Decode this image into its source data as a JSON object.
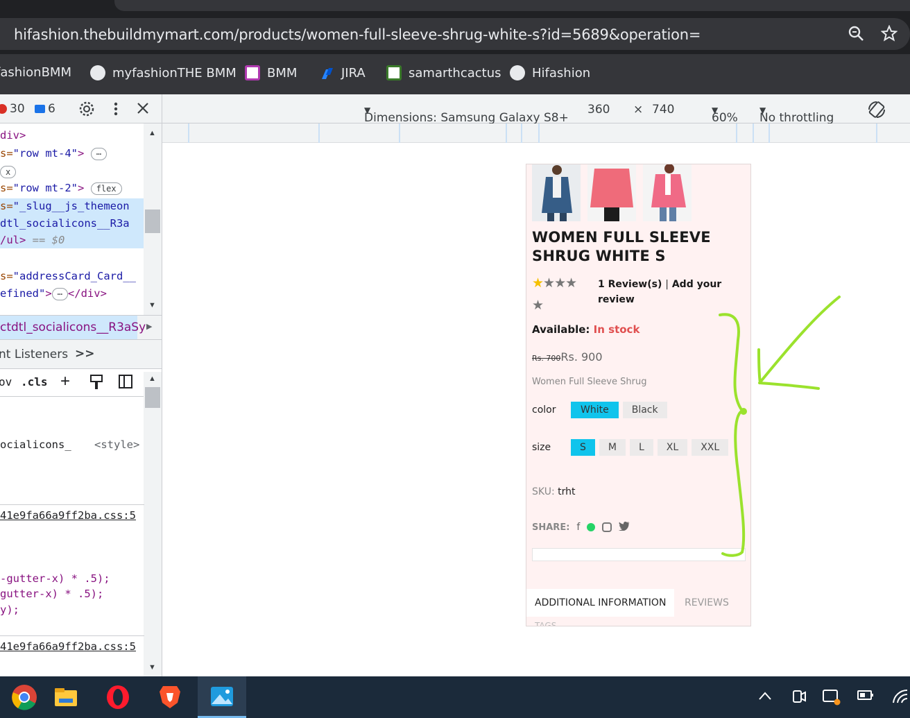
{
  "browser": {
    "url": "hifashion.thebuildmymart.com/products/women-full-sleeve-shrug-white-s?id=5689&operation=",
    "bookmarks": [
      "fashionBMM",
      "myfashionTHE BMM",
      "BMM",
      "JIRA",
      "samarthcactus",
      "Hifashion"
    ]
  },
  "devtools": {
    "error_count": "30",
    "message_count": "6",
    "code_lines": {
      "l1": "div>",
      "l2_attr": "s=",
      "l2_val": "\"row mt-4\"",
      "l2_end": ">",
      "l3": "x",
      "l4_attr": "s=",
      "l4_val": "\"row mt-2\"",
      "l4_end": ">",
      "flex_badge": "flex",
      "l5_attr": "s=",
      "l5_val": "\"_slug__js_themeon",
      "l6_val": "dtl_socialicons__R3a",
      "l7_tag": "/ul>",
      "l7_dim": "== $0",
      "l8_attr": "s=",
      "l8_val": "\"addressCard_Card__",
      "l9_val": "efined\"",
      "l9_end": "</div>"
    },
    "breadcrumb_selected": "ctdtl_socialicons__R3aSy",
    "panel_tabs": "nt Listeners",
    "more_tabs": ">>",
    "styles_tools": [
      "ov",
      ".cls"
    ],
    "style_rules": {
      "selector": "ocialicons_",
      "source": "<style>",
      "file1": "41e9fa66a9ff2ba.css:5",
      "gutter1": "-gutter-x) * .5);",
      "gutter2": "gutter-x) * .5);",
      "gutter3": "y);",
      "file2": "41e9fa66a9ff2ba.css:5"
    }
  },
  "device_toolbar": {
    "dimensions_label": "Dimensions: Samsung Galaxy S8+",
    "width": "360",
    "times": "×",
    "height": "740",
    "zoom": "60%",
    "throttling": "No throttling"
  },
  "product": {
    "title": "WOMEN FULL SLEEVE SHRUG WHITE S",
    "rating_stars_filled": 1,
    "rating_stars_total": 5,
    "reviews_count_text": "1 Review(s)",
    "review_separator": "|",
    "add_review": "Add your review",
    "availability_label": "Available:",
    "availability_value": "In stock",
    "old_price": "Rs. 700",
    "price": "Rs. 900",
    "description": "Women Full Sleeve Shrug",
    "color_label": "color",
    "colors": [
      "White",
      "Black"
    ],
    "selected_color": "White",
    "size_label": "size",
    "sizes": [
      "S",
      "M",
      "L",
      "XL",
      "XXL"
    ],
    "selected_size": "S",
    "sku_label": "SKU:",
    "sku_value": "trht",
    "share_label": "SHARE:",
    "tabs": [
      "ADDITIONAL INFORMATION",
      "REVIEWS"
    ],
    "tags_partial": "TAGS"
  },
  "colors": {
    "accent": "#10c4ec",
    "annotation": "#9be22d",
    "in_stock": "#e05050",
    "star_gold": "#f5c000"
  }
}
